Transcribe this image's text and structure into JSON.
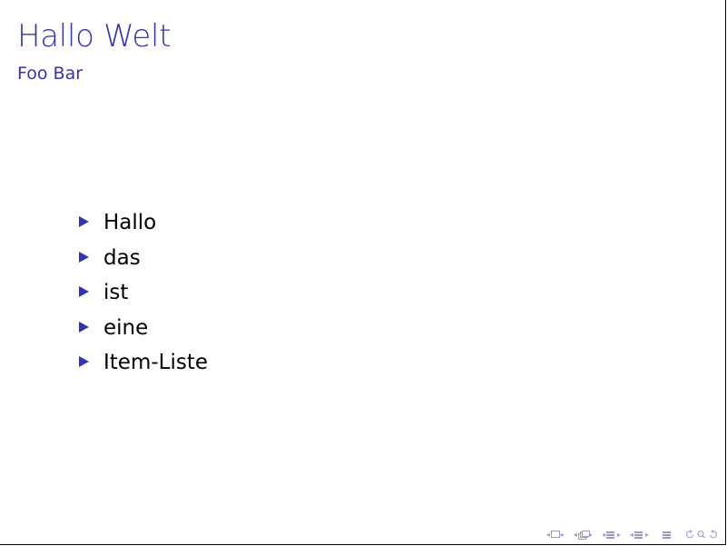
{
  "slide": {
    "title": "Hallo Welt",
    "subtitle": "Foo Bar",
    "items": [
      "Hallo",
      "das",
      "ist",
      "eine",
      "Item-Liste"
    ]
  },
  "colors": {
    "accent": "#3333b3",
    "text": "#000000",
    "nav": "#9a9ad0"
  },
  "navigation": {
    "icons": [
      "frame-prev-icon",
      "frame-icon",
      "frame-next-icon",
      "subsection-prev-icon",
      "subsection-icon",
      "subsection-next-icon",
      "section-prev-icon",
      "section-icon",
      "section-next-icon",
      "subsubsection-prev-icon",
      "subsubsection-icon",
      "subsubsection-next-icon",
      "align-icon",
      "back-icon",
      "search-icon",
      "forward-icon"
    ]
  }
}
